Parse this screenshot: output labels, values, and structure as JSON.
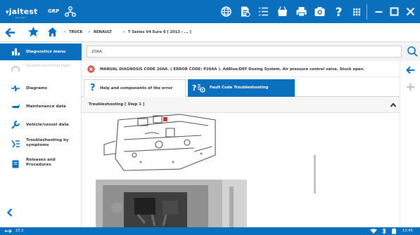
{
  "app": {
    "logo": "jaltest",
    "logo_sub": "by cojali",
    "grp_label": "GRP"
  },
  "toolbar": {
    "icons": [
      "globe-icon",
      "document-icon",
      "list-icon",
      "shopping-cart-icon",
      "printer-icon",
      "camera-icon",
      "help-icon",
      "apps-grid-icon",
      "minimize-icon",
      "maximize-icon",
      "close-icon"
    ]
  },
  "breadcrumb": {
    "items": [
      "TRUCK",
      "RENAULT",
      "T Series V4 Euro 6 [ 2013 - ... ]"
    ],
    "separator": ">"
  },
  "sidebar": {
    "items": [
      {
        "label": "Diagnostics menu",
        "active": true,
        "disabled": false
      },
      {
        "label": "System technical data",
        "active": false,
        "disabled": true
      },
      {
        "label": "Diagrams",
        "active": false,
        "disabled": false
      },
      {
        "label": "Maintenance data",
        "active": false,
        "disabled": false
      },
      {
        "label": "Vehicle/vessel data",
        "active": false,
        "disabled": false
      },
      {
        "label": "Troubleshooting by symptoms",
        "active": false,
        "disabled": false
      },
      {
        "label": "Releases and Procedures",
        "active": false,
        "disabled": false
      }
    ]
  },
  "search": {
    "value": "20AA"
  },
  "error": {
    "text": "MANUAL DIAGNOSIS CODE 20AA. ( ERROR CODE: P20AA ). AdBlue/DEF Dosing System. Air pressure control valve. Stuck open."
  },
  "tabs": {
    "help_label": "Help and components of the error",
    "fault_label": "Fault Code Troubleshooting"
  },
  "section": {
    "title": "Troubleshooting [ Step 1 ]"
  },
  "status": {
    "left_text": "22.2",
    "time": "12:45"
  },
  "colors": {
    "brand": "#0a6fbd",
    "error": "#d9534f"
  }
}
